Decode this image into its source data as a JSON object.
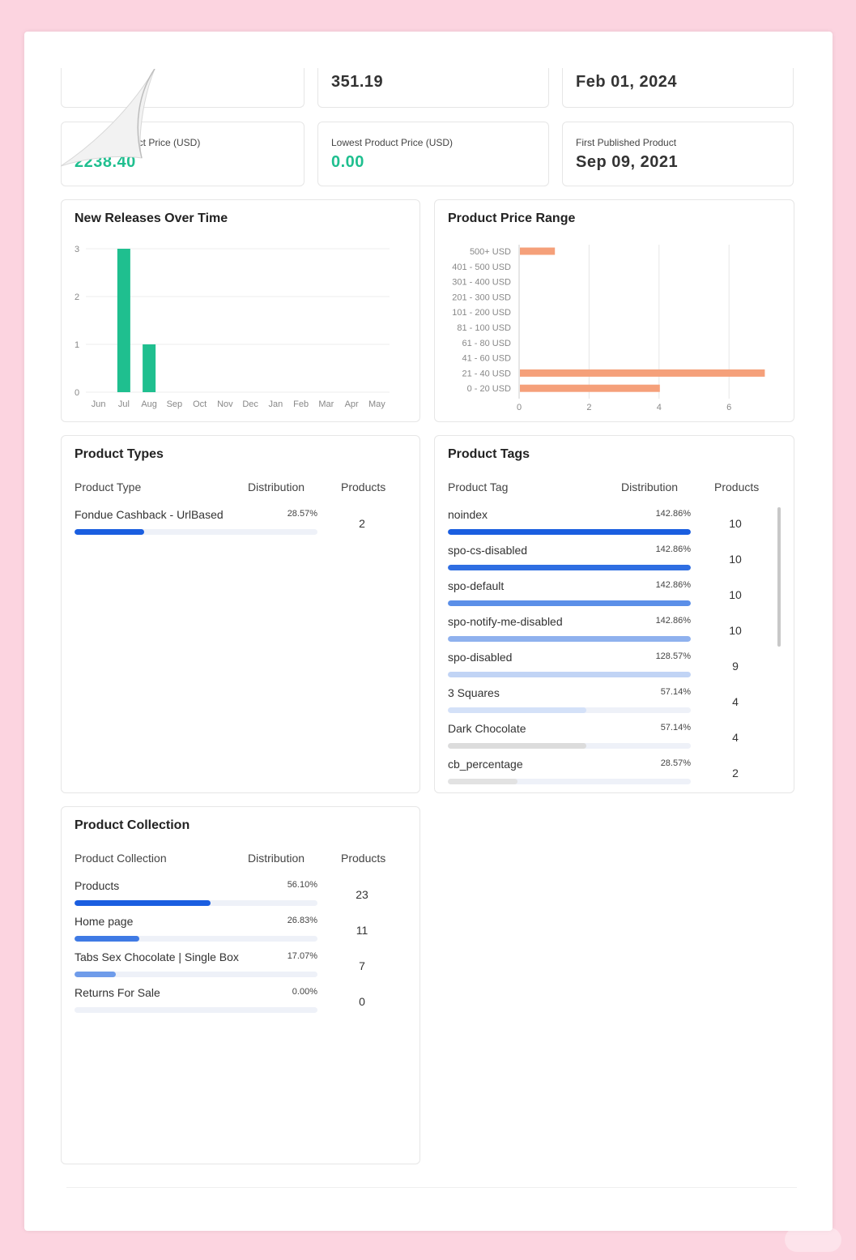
{
  "stats": {
    "top_value_1": "351.19",
    "top_value_2": "Feb 01, 2024",
    "highest_label": "uct Price (USD)",
    "highest_value": "2238.40",
    "lowest_label": "Lowest Product Price (USD)",
    "lowest_value": "0.00",
    "first_label": "First Published Product",
    "first_value": "Sep 09, 2021"
  },
  "releases": {
    "title": "New Releases Over Time",
    "chart_data": {
      "type": "bar",
      "categories": [
        "Jun",
        "Jul",
        "Aug",
        "Sep",
        "Oct",
        "Nov",
        "Dec",
        "Jan",
        "Feb",
        "Mar",
        "Apr",
        "May"
      ],
      "values": [
        0,
        3,
        1,
        0,
        0,
        0,
        0,
        0,
        0,
        0,
        0,
        0
      ],
      "ylim": [
        0,
        3
      ],
      "yticks": [
        "0",
        "1",
        "2",
        "3"
      ],
      "grid": true,
      "color": "#1fbf8f"
    }
  },
  "price_range": {
    "title": "Product Price Range",
    "chart_data": {
      "type": "bar",
      "orientation": "horizontal",
      "categories": [
        "500+ USD",
        "401 - 500 USD",
        "301 - 400 USD",
        "201 - 300 USD",
        "101 - 200 USD",
        "81 - 100 USD",
        "61 - 80 USD",
        "41 - 60 USD",
        "21 - 40 USD",
        "0 - 20 USD"
      ],
      "values": [
        1,
        0,
        0,
        0,
        0,
        0,
        0,
        0,
        7,
        4
      ],
      "xlim": [
        0,
        7
      ],
      "xticks": [
        "0",
        "2",
        "4",
        "6"
      ],
      "grid": true,
      "color": "#f5a07a"
    }
  },
  "types": {
    "title": "Product Types",
    "col_name": "Product Type",
    "col_dist": "Distribution",
    "col_count": "Products",
    "rows": [
      {
        "name": "Fondue Cashback - UrlBased",
        "pct": "28.57%",
        "fraction": 0.2857,
        "count": "2",
        "color": "#1a5ee0"
      }
    ]
  },
  "tags": {
    "title": "Product Tags",
    "col_name": "Product Tag",
    "col_dist": "Distribution",
    "col_count": "Products",
    "rows": [
      {
        "name": "noindex",
        "pct": "142.86%",
        "fraction": 1.0,
        "count": "10",
        "color": "#1a5ee0"
      },
      {
        "name": "spo-cs-disabled",
        "pct": "142.86%",
        "fraction": 1.0,
        "count": "10",
        "color": "#2f6ee2"
      },
      {
        "name": "spo-default",
        "pct": "142.86%",
        "fraction": 1.0,
        "count": "10",
        "color": "#5b8fe8"
      },
      {
        "name": "spo-notify-me-disabled",
        "pct": "142.86%",
        "fraction": 1.0,
        "count": "10",
        "color": "#8fb1ee"
      },
      {
        "name": "spo-disabled",
        "pct": "128.57%",
        "fraction": 1.0,
        "count": "9",
        "color": "#c1d4f5"
      },
      {
        "name": "3 Squares",
        "pct": "57.14%",
        "fraction": 0.5714,
        "count": "4",
        "color": "#d4e1f8"
      },
      {
        "name": "Dark Chocolate",
        "pct": "57.14%",
        "fraction": 0.5714,
        "count": "4",
        "color": "#dcdcdc"
      },
      {
        "name": "cb_percentage",
        "pct": "28.57%",
        "fraction": 0.2857,
        "count": "2",
        "color": "#e2e2e2"
      }
    ]
  },
  "collections": {
    "title": "Product Collection",
    "col_name": "Product Collection",
    "col_dist": "Distribution",
    "col_count": "Products",
    "rows": [
      {
        "name": "Products",
        "pct": "56.10%",
        "fraction": 0.561,
        "count": "23",
        "color": "#1a5ee0"
      },
      {
        "name": "Home page",
        "pct": "26.83%",
        "fraction": 0.2683,
        "count": "11",
        "color": "#3f7ae4"
      },
      {
        "name": "Tabs Sex Chocolate | Single Box",
        "pct": "17.07%",
        "fraction": 0.1707,
        "count": "7",
        "color": "#6f9cea"
      },
      {
        "name": "Returns For Sale",
        "pct": "0.00%",
        "fraction": 0.0,
        "count": "0",
        "color": "#a9c3f0"
      }
    ]
  }
}
